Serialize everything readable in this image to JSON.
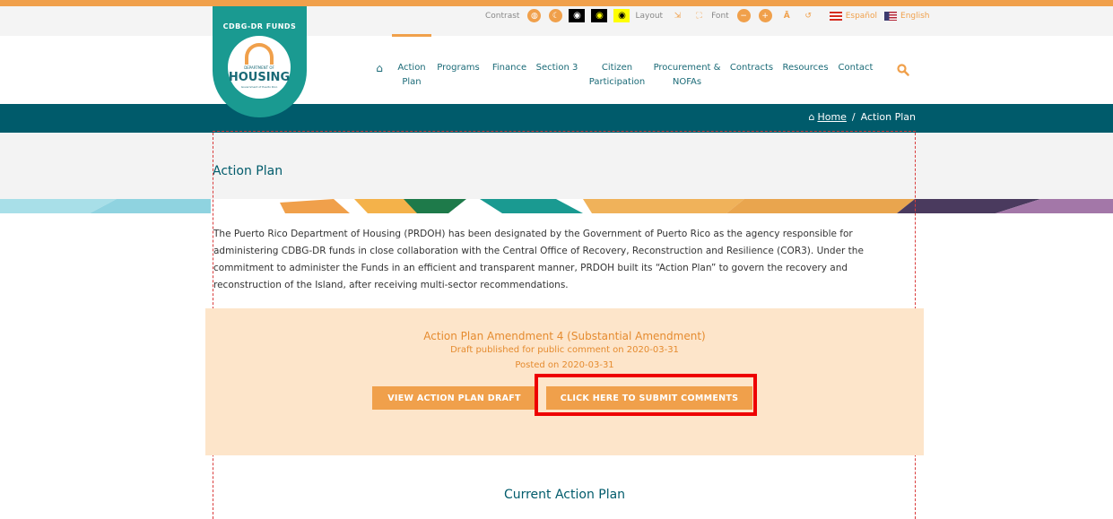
{
  "topbar": {
    "contrast_label": "Contrast",
    "layout_label": "Layout",
    "font_label": "Font",
    "lang_es": "Español",
    "lang_en": "English"
  },
  "logo": {
    "arc_text": "CDBG-DR FUNDS",
    "dept": "DEPARTMENT OF",
    "name": "HOUSING",
    "sub": "Government of Puerto Rico"
  },
  "nav": {
    "items": [
      {
        "line1": "Action",
        "line2": "Plan"
      },
      {
        "line1": "Programs"
      },
      {
        "line1": "Finance"
      },
      {
        "line1": "Section 3"
      },
      {
        "line1": "Citizen",
        "line2": "Participation"
      },
      {
        "line1": "Procurement &",
        "line2": "NOFAs"
      },
      {
        "line1": "Contracts"
      },
      {
        "line1": "Resources"
      },
      {
        "line1": "Contact"
      }
    ]
  },
  "breadcrumb": {
    "home": "Home",
    "separator": "/",
    "current": "Action Plan"
  },
  "page": {
    "title": "Action Plan",
    "intro": "The Puerto Rico Department of Housing (PRDOH) has been designated by the Government of Puerto Rico as the agency responsible for administering CDBG-DR funds in close collaboration with the Central Office of Recovery, Reconstruction and Resilience (COR3). Under the commitment to administer the Funds in an efficient and transparent manner, PRDOH built its “Action Plan” to govern the recovery and reconstruction of the Island, after receiving multi-sector recommendations."
  },
  "amendment": {
    "title": "Action Plan Amendment 4 (Substantial Amendment)",
    "draft": "Draft published for public comment on 2020-03-31",
    "posted": "Posted on 2020-03-31",
    "view_button": "VIEW ACTION PLAN DRAFT",
    "comment_button": "CLICK HERE TO SUBMIT COMMENTS"
  },
  "current": {
    "title": "Current Action Plan"
  },
  "colors": {
    "teal": "#005b6b",
    "logo_teal": "#1a9a91",
    "orange": "#f0a04b",
    "amendment_bg": "#fde5ca",
    "highlight": "#ee0000"
  }
}
